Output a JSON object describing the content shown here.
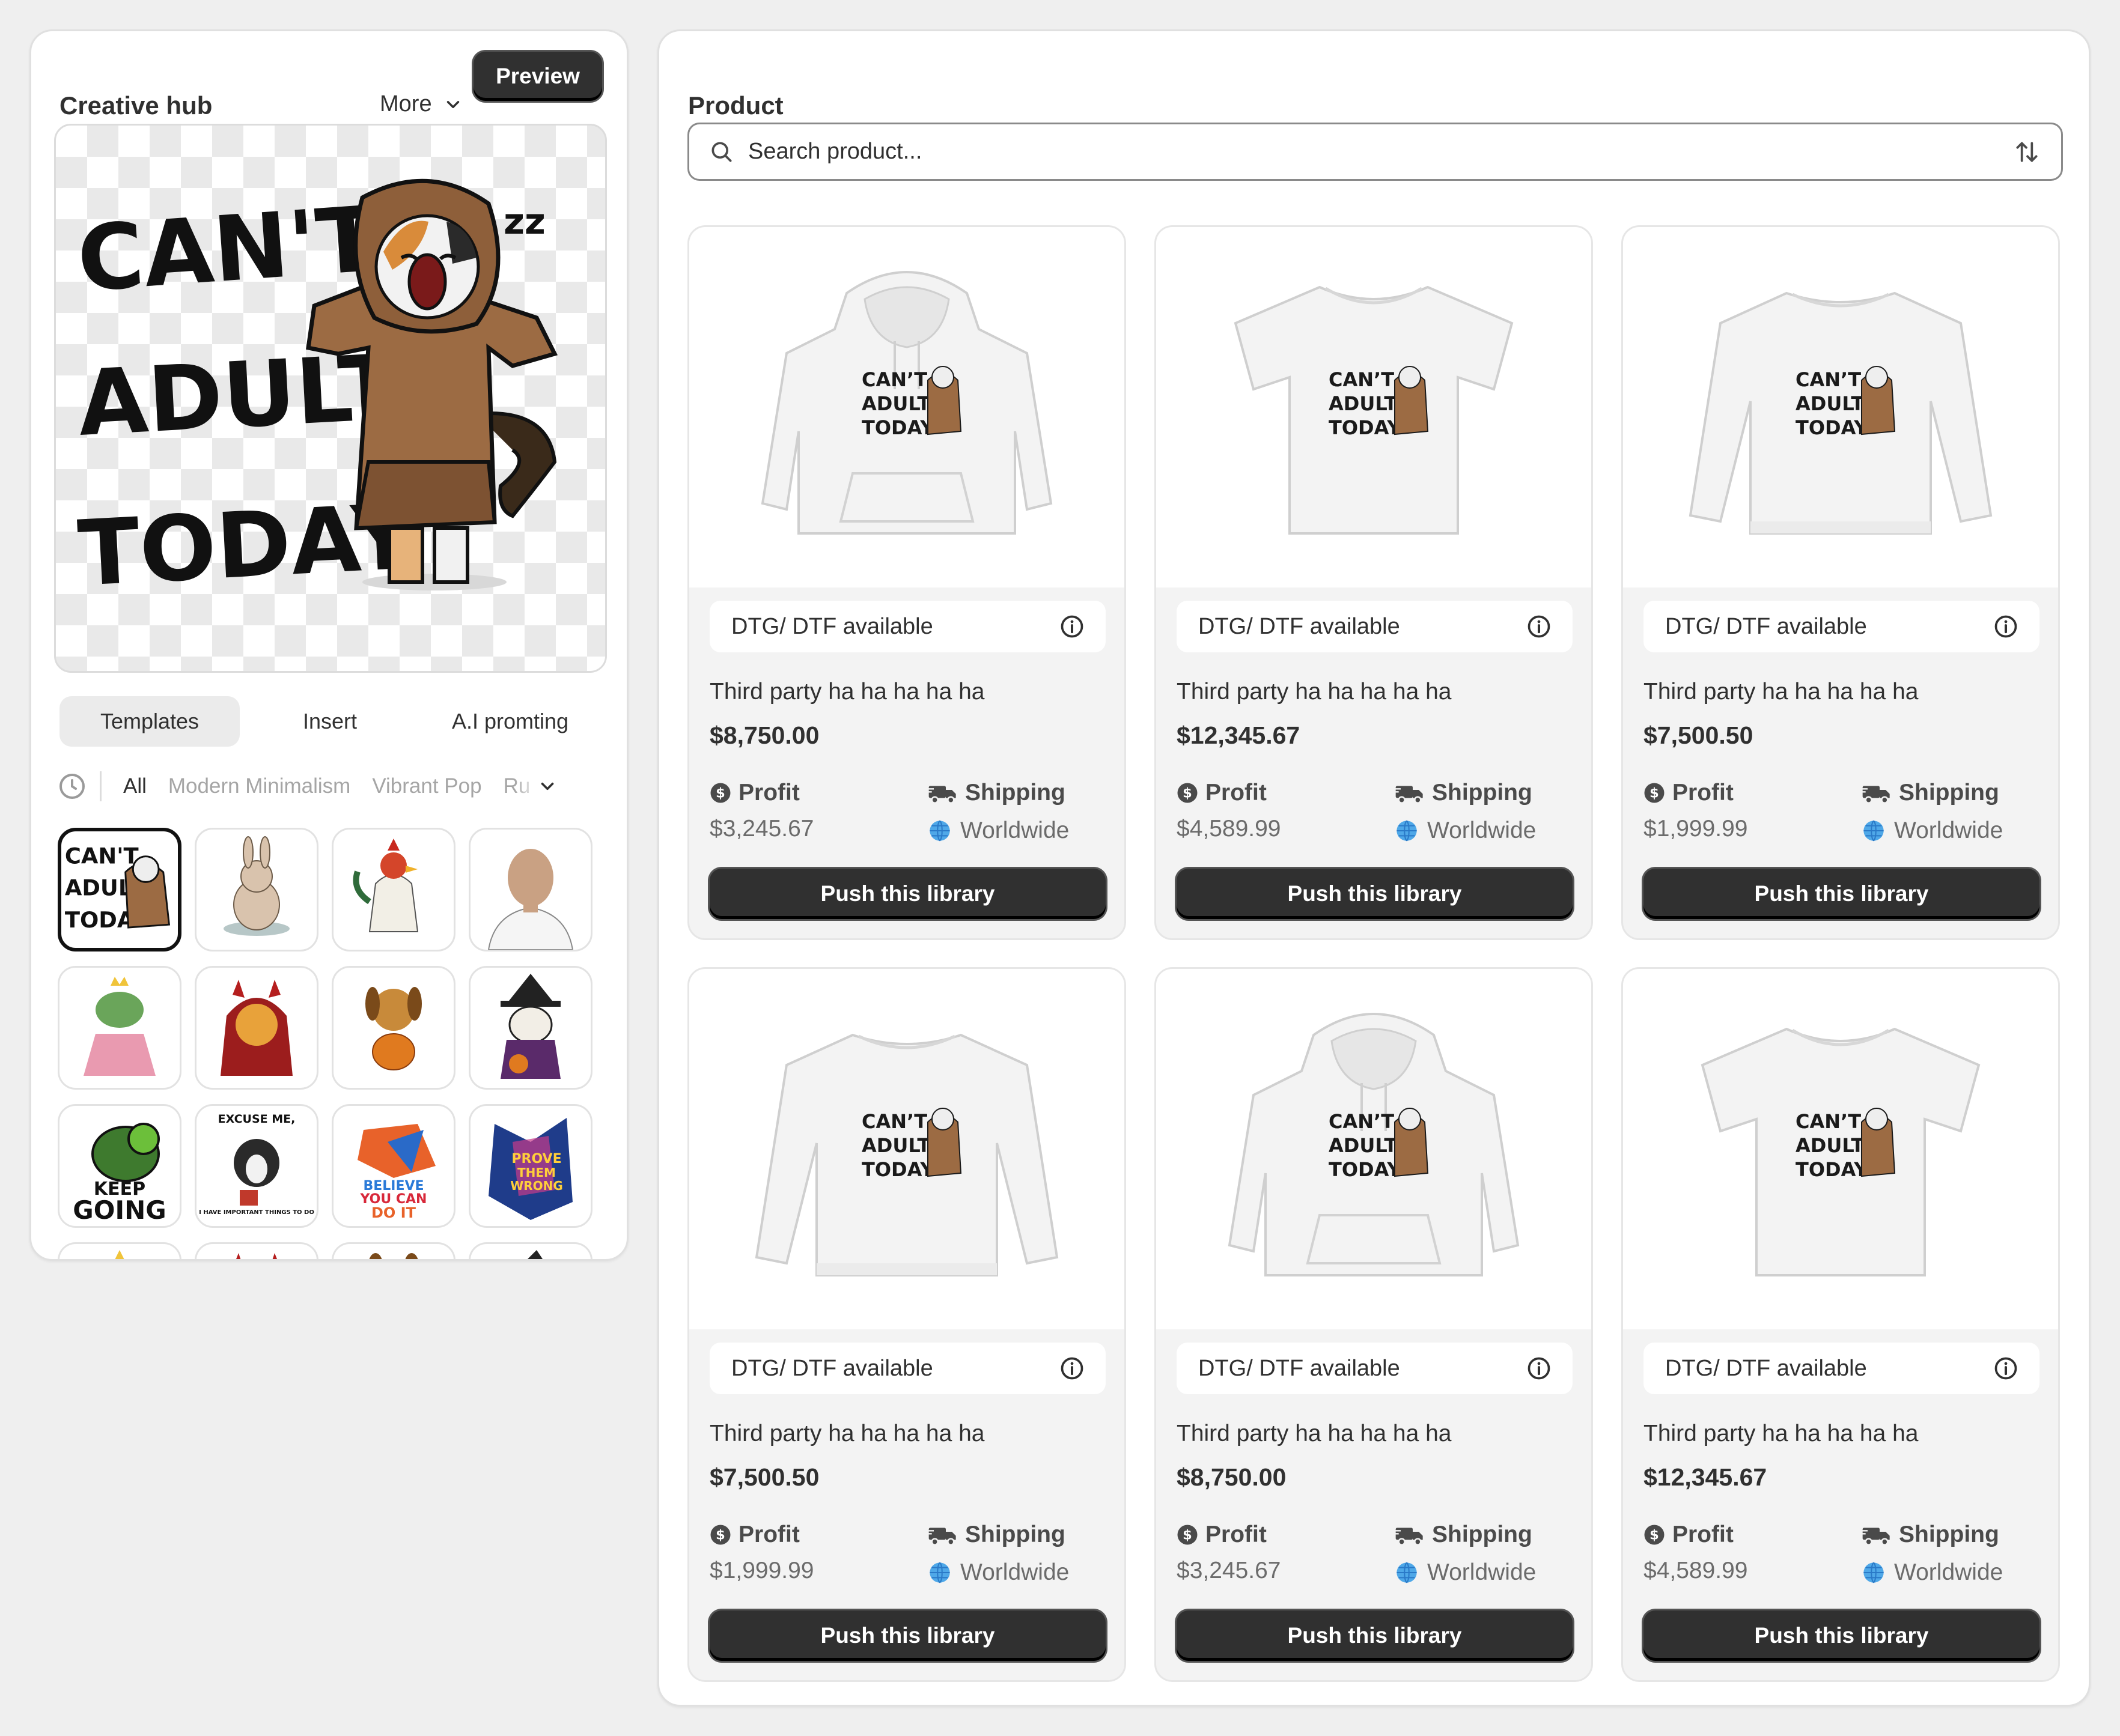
{
  "creative_hub": {
    "title": "Creative hub",
    "more_label": "More",
    "preview_label": "Preview",
    "canvas_artwork": {
      "line1": "CAN'T",
      "line2": "ADULT",
      "line3": "TODAY",
      "zz": "zz"
    },
    "tabs": [
      "Templates",
      "Insert",
      "A.I promting"
    ],
    "active_tab": "Templates",
    "filters": [
      "All",
      "Modern Minimalism",
      "Vibrant Pop",
      "Ru"
    ],
    "active_filter": "All",
    "thumb_texts": {
      "t1": [
        "CAN'T",
        "ADULT",
        "TODAY"
      ],
      "t10": "EXCUSE ME,",
      "t10b": "I HAVE IMPORTANT THINGS TO DO",
      "t9a": "KEEP",
      "t9b": "GOING",
      "t11a": "BELIEVE",
      "t11b": "YOU CAN",
      "t11c": "DO IT",
      "t12a": "PROVE",
      "t12b": "THEM",
      "t12c": "WRONG"
    }
  },
  "product_panel": {
    "title": "Product",
    "search_placeholder": "Search product...",
    "products": [
      {
        "type": "hoodie",
        "availability": "DTG/ DTF available",
        "name": "Third party ha ha ha ha ha",
        "price": "$8,750.00",
        "profit_label": "Profit",
        "profit_value": "$3,245.67",
        "shipping_label": "Shipping",
        "shipping_value": "Worldwide",
        "button": "Push this library"
      },
      {
        "type": "tshirt",
        "availability": "DTG/ DTF available",
        "name": "Third party ha ha ha ha ha",
        "price": "$12,345.67",
        "profit_label": "Profit",
        "profit_value": "$4,589.99",
        "shipping_label": "Shipping",
        "shipping_value": "Worldwide",
        "button": "Push this library"
      },
      {
        "type": "sweatshirt",
        "availability": "DTG/ DTF available",
        "name": "Third party ha ha ha ha ha",
        "price": "$7,500.50",
        "profit_label": "Profit",
        "profit_value": "$1,999.99",
        "shipping_label": "Shipping",
        "shipping_value": "Worldwide",
        "button": "Push this library"
      },
      {
        "type": "sweatshirt",
        "availability": "DTG/ DTF available",
        "name": "Third party ha ha ha ha ha",
        "price": "$7,500.50",
        "profit_label": "Profit",
        "profit_value": "$1,999.99",
        "shipping_label": "Shipping",
        "shipping_value": "Worldwide",
        "button": "Push this library"
      },
      {
        "type": "hoodie",
        "availability": "DTG/ DTF available",
        "name": "Third party ha ha ha ha ha",
        "price": "$8,750.00",
        "profit_label": "Profit",
        "profit_value": "$3,245.67",
        "shipping_label": "Shipping",
        "shipping_value": "Worldwide",
        "button": "Push this library"
      },
      {
        "type": "tshirt",
        "availability": "DTG/ DTF available",
        "name": "Third party ha ha ha ha ha",
        "price": "$12,345.67",
        "profit_label": "Profit",
        "profit_value": "$4,589.99",
        "shipping_label": "Shipping",
        "shipping_value": "Worldwide",
        "button": "Push this library"
      }
    ]
  },
  "colors": {
    "button_dark": "#303030",
    "background": "#efefef",
    "card_bg": "#f3f3f3"
  }
}
